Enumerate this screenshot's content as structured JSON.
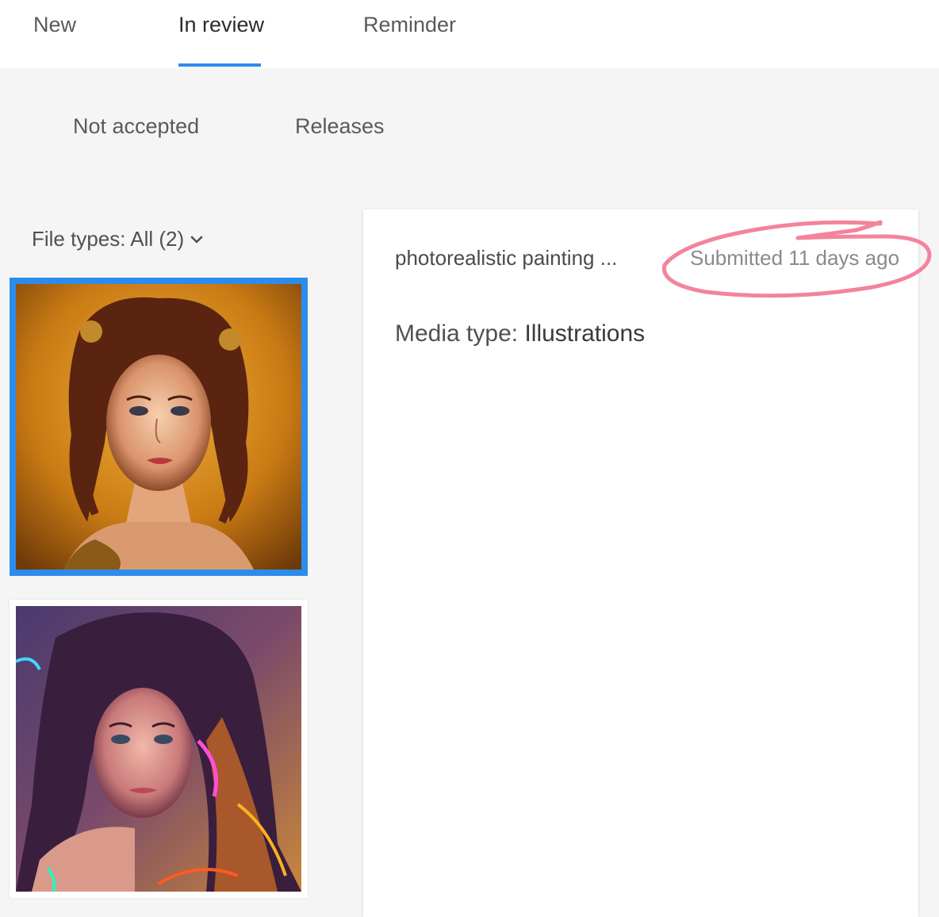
{
  "tabs": [
    {
      "label": "New",
      "active": false
    },
    {
      "label": "In review",
      "active": true
    },
    {
      "label": "Reminder",
      "active": false
    }
  ],
  "subtabs": [
    {
      "label": "Not accepted"
    },
    {
      "label": "Releases"
    }
  ],
  "filter": {
    "label": "File types: All (2)",
    "icon": "chevron-down-icon"
  },
  "thumbnails": [
    {
      "selected": true,
      "description_icon": "portrait-image"
    },
    {
      "selected": false,
      "description_icon": "portrait-image"
    }
  ],
  "detail": {
    "title": "photorealistic painting ...",
    "submitted": "Submitted 11 days ago",
    "media_type_label": "Media type:",
    "media_type_value": "Illustrations"
  },
  "colors": {
    "accent": "#2d8ceb",
    "annotation": "#f4839c",
    "background": "#f5f5f5"
  }
}
